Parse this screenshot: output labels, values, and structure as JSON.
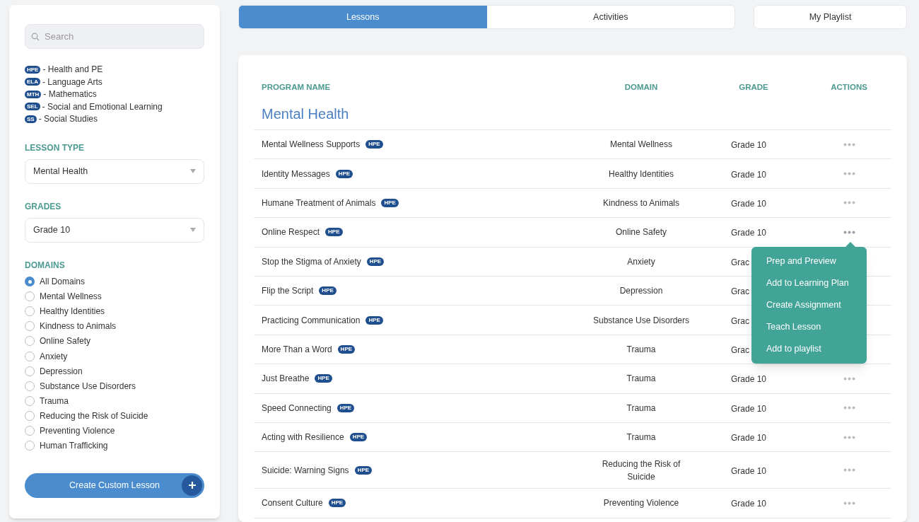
{
  "search": {
    "placeholder": "Search"
  },
  "legend": [
    {
      "code": "HPE",
      "label": "- Health and PE"
    },
    {
      "code": "ELA",
      "label": "- Language Arts"
    },
    {
      "code": "MTH",
      "label": "- Mathematics"
    },
    {
      "code": "SEL",
      "label": "- Social and Emotional Learning"
    },
    {
      "code": "SS",
      "label": "- Social Studies"
    }
  ],
  "filters": [
    {
      "label": "LESSON TYPE",
      "value": "Mental Health"
    },
    {
      "label": "GRADES",
      "value": "Grade 10"
    }
  ],
  "domains": {
    "label": "DOMAINS",
    "options": [
      {
        "label": "All Domains",
        "selected": true
      },
      {
        "label": "Mental Wellness",
        "selected": false
      },
      {
        "label": "Healthy Identities",
        "selected": false
      },
      {
        "label": "Kindness to Animals",
        "selected": false
      },
      {
        "label": "Online Safety",
        "selected": false
      },
      {
        "label": "Anxiety",
        "selected": false
      },
      {
        "label": "Depression",
        "selected": false
      },
      {
        "label": "Substance Use Disorders",
        "selected": false
      },
      {
        "label": "Trauma",
        "selected": false
      },
      {
        "label": "Reducing the Risk of Suicide",
        "selected": false
      },
      {
        "label": "Preventing Violence",
        "selected": false
      },
      {
        "label": "Human Trafficking",
        "selected": false
      }
    ]
  },
  "create_button": "Create Custom Lesson",
  "tabs": [
    {
      "label": "Lessons",
      "selected": true
    },
    {
      "label": "Activities",
      "selected": false
    }
  ],
  "playlist_button": "My Playlist",
  "table": {
    "columns": [
      "PROGRAM NAME",
      "DOMAIN",
      "GRADE",
      "ACTIONS"
    ],
    "group": "Mental Health",
    "rows": [
      {
        "name": "Mental Wellness Supports",
        "tag": "HPE",
        "domain": "Mental Wellness",
        "grade": "Grade 10",
        "menu_open": false
      },
      {
        "name": "Identity Messages",
        "tag": "HPE",
        "domain": "Healthy Identities",
        "grade": "Grade 10",
        "menu_open": false
      },
      {
        "name": "Humane Treatment of Animals",
        "tag": "HPE",
        "domain": "Kindness to Animals",
        "grade": "Grade 10",
        "menu_open": false
      },
      {
        "name": "Online Respect",
        "tag": "HPE",
        "domain": "Online Safety",
        "grade": "Grade 10",
        "menu_open": true
      },
      {
        "name": "Stop the Stigma of Anxiety",
        "tag": "HPE",
        "domain": "Anxiety",
        "grade": "Grac",
        "menu_open": false
      },
      {
        "name": "Flip the Script",
        "tag": "HPE",
        "domain": "Depression",
        "grade": "Grac",
        "menu_open": false
      },
      {
        "name": "Practicing Communication",
        "tag": "HPE",
        "domain": "Substance Use Disorders",
        "grade": "Grac",
        "menu_open": false
      },
      {
        "name": "More Than a Word",
        "tag": "HPE",
        "domain": "Trauma",
        "grade": "Grac",
        "menu_open": false
      },
      {
        "name": "Just Breathe",
        "tag": "HPE",
        "domain": "Trauma",
        "grade": "Grade 10",
        "menu_open": false
      },
      {
        "name": "Speed Connecting",
        "tag": "HPE",
        "domain": "Trauma",
        "grade": "Grade 10",
        "menu_open": false
      },
      {
        "name": "Acting with Resilience",
        "tag": "HPE",
        "domain": "Trauma",
        "grade": "Grade 10",
        "menu_open": false
      },
      {
        "name": "Suicide: Warning Signs",
        "tag": "HPE",
        "domain": "Reducing the Risk of Suicide",
        "grade": "Grade 10",
        "menu_open": false
      },
      {
        "name": "Consent Culture",
        "tag": "HPE",
        "domain": "Preventing Violence",
        "grade": "Grade 10",
        "menu_open": false
      }
    ]
  },
  "action_menu": [
    "Prep and Preview",
    "Add to Learning Plan",
    "Create Assignment",
    "Teach Lesson",
    "Add to playlist"
  ]
}
